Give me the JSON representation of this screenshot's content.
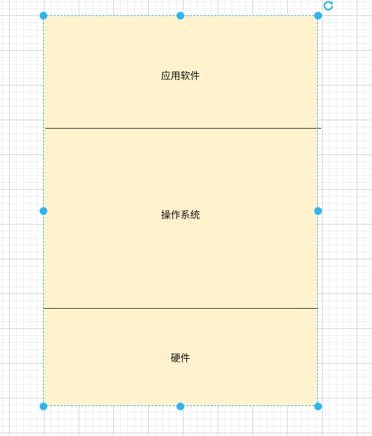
{
  "diagram": {
    "layers": [
      {
        "id": "app",
        "label": "应用软件"
      },
      {
        "id": "os",
        "label": "操作系统"
      },
      {
        "id": "hw",
        "label": "硬件"
      }
    ]
  },
  "colors": {
    "shape_fill": "#fff2cc",
    "selection": "#29b6f2",
    "divider": "#333333",
    "grid_major": "#d4d4d4",
    "grid_minor": "#efefef"
  },
  "icons": {
    "rotate": "rotate-icon",
    "resize_handle": "resize-handle"
  }
}
